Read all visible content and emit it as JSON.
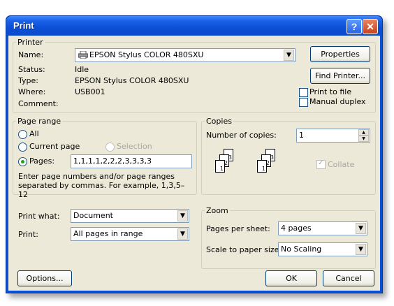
{
  "window": {
    "title": "Print",
    "help_glyph": "?",
    "close_glyph": "✕"
  },
  "printer": {
    "legend": "Printer",
    "name_label": "Name:",
    "name_value": "EPSON Stylus COLOR 480SXU",
    "status_label": "Status:",
    "status_value": "Idle",
    "type_label": "Type:",
    "type_value": "EPSON Stylus COLOR 480SXU",
    "where_label": "Where:",
    "where_value": "USB001",
    "comment_label": "Comment:",
    "properties_button": "Properties",
    "find_printer_button": "Find Printer...",
    "print_to_file": "Print to file",
    "manual_duplex": "Manual duplex"
  },
  "page_range": {
    "legend": "Page range",
    "all": "All",
    "current_page": "Current page",
    "selection": "Selection",
    "pages": "Pages:",
    "pages_value": "1,1,1,1,2,2,2,3,3,3,3",
    "hint": "Enter page numbers and/or page ranges separated by commas.  For example, 1,3,5–12"
  },
  "copies": {
    "legend": "Copies",
    "number_label": "Number of copies:",
    "number_value": "1",
    "collate": "Collate",
    "collate_icon_labels": [
      "1",
      "2",
      "3"
    ]
  },
  "print_what": {
    "label": "Print what:",
    "value": "Document"
  },
  "print": {
    "label": "Print:",
    "value": "All pages in range"
  },
  "zoom": {
    "legend": "Zoom",
    "pages_per_sheet_label": "Pages per sheet:",
    "pages_per_sheet_value": "4 pages",
    "scale_label": "Scale to paper size:",
    "scale_value": "No Scaling"
  },
  "footer": {
    "options": "Options...",
    "ok": "OK",
    "cancel": "Cancel"
  },
  "icons": {
    "printer": "printer-icon",
    "dropdown": "chevron-down-icon",
    "spinner_up": "spin-up-icon",
    "spinner_down": "spin-down-icon"
  }
}
